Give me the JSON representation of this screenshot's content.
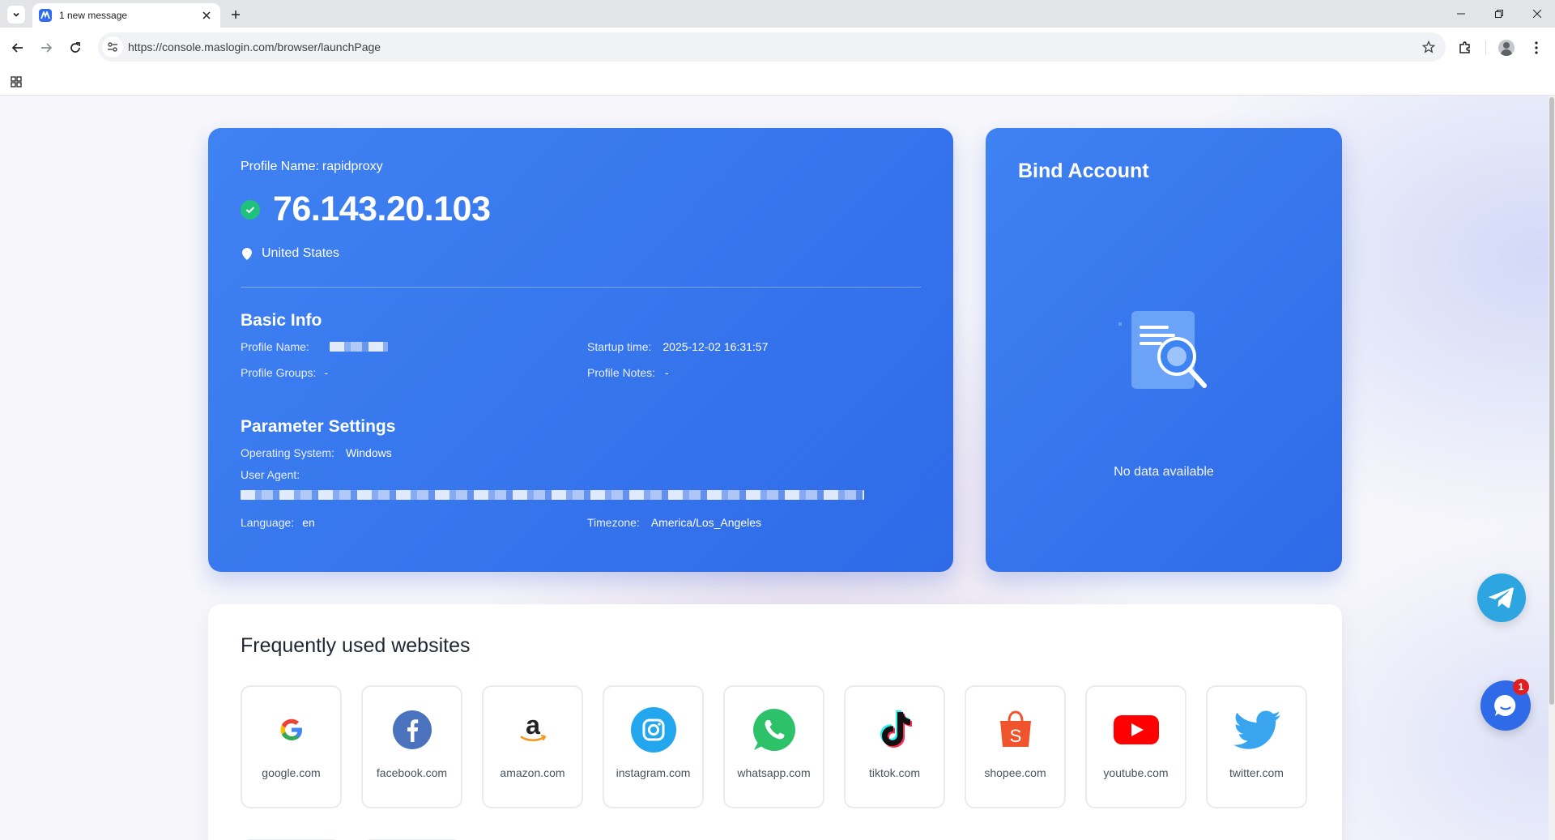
{
  "browser": {
    "tab_title": "1 new message",
    "url": "https://console.maslogin.com/browser/launchPage"
  },
  "profile": {
    "name_label": "Profile Name:",
    "name_value": "rapidproxy",
    "ip": "76.143.20.103",
    "country": "United States",
    "basic_info": {
      "title": "Basic Info",
      "profile_name_label": "Profile Name:",
      "startup_time_label": "Startup time:",
      "startup_time_value": "2025-12-02 16:31:57",
      "profile_groups_label": "Profile Groups:",
      "profile_groups_value": "-",
      "profile_notes_label": "Profile Notes:",
      "profile_notes_value": "-"
    },
    "parameters": {
      "title": "Parameter Settings",
      "os_label": "Operating System:",
      "os_value": "Windows",
      "user_agent_label": "User Agent:",
      "language_label": "Language:",
      "language_value": "en",
      "timezone_label": "Timezone:",
      "timezone_value": "America/Los_Angeles"
    }
  },
  "bind_account": {
    "title": "Bind Account",
    "empty_text": "No data available"
  },
  "websites": {
    "title": "Frequently used websites",
    "items": [
      {
        "label": "google.com",
        "icon": "google-icon"
      },
      {
        "label": "facebook.com",
        "icon": "facebook-icon"
      },
      {
        "label": "amazon.com",
        "icon": "amazon-icon"
      },
      {
        "label": "instagram.com",
        "icon": "instagram-icon"
      },
      {
        "label": "whatsapp.com",
        "icon": "whatsapp-icon"
      },
      {
        "label": "tiktok.com",
        "icon": "tiktok-icon"
      },
      {
        "label": "shopee.com",
        "icon": "shopee-icon"
      },
      {
        "label": "youtube.com",
        "icon": "youtube-icon"
      },
      {
        "label": "twitter.com",
        "icon": "twitter-icon"
      }
    ]
  },
  "chat": {
    "badge_count": "1"
  },
  "colors": {
    "card_blue": "#3a78ef",
    "success_green": "#1fc27a",
    "telegram": "#2ca5e0",
    "badge_red": "#e02020"
  }
}
